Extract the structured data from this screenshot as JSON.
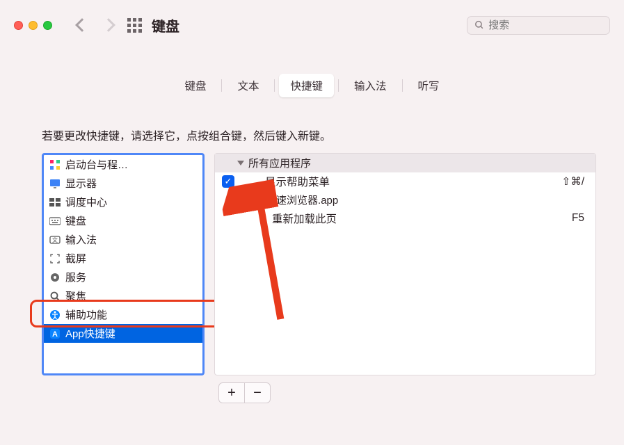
{
  "window": {
    "title": "键盘",
    "searchPlaceholder": "搜索"
  },
  "tabs": [
    "键盘",
    "文本",
    "快捷键",
    "输入法",
    "听写"
  ],
  "selectedTabIndex": 2,
  "instruction": "若要更改快捷键，请选择它，点按组合键，然后键入新键。",
  "categories": [
    {
      "label": "启动台与程…",
      "icon": "launchpad-icon"
    },
    {
      "label": "显示器",
      "icon": "display-icon"
    },
    {
      "label": "调度中心",
      "icon": "mission-icon"
    },
    {
      "label": "键盘",
      "icon": "keyboard-icon"
    },
    {
      "label": "输入法",
      "icon": "input-icon"
    },
    {
      "label": "截屏",
      "icon": "screenshot-icon"
    },
    {
      "label": "服务",
      "icon": "services-icon"
    },
    {
      "label": "聚焦",
      "icon": "spotlight-icon"
    },
    {
      "label": "辅助功能",
      "icon": "accessibility-icon"
    },
    {
      "label": "App快捷键",
      "icon": "app-shortcut-icon",
      "selected": true
    }
  ],
  "shortcuts": {
    "groups": [
      {
        "name": "所有应用程序",
        "items": [
          {
            "checked": true,
            "label": "显示帮助菜单",
            "key": "⇧⌘/"
          }
        ]
      },
      {
        "name": "360极速浏览器.app",
        "items": [
          {
            "checked": false,
            "label": "重新加载此页",
            "key": "F5"
          }
        ]
      }
    ]
  },
  "buttons": {
    "add": "+",
    "remove": "−"
  }
}
